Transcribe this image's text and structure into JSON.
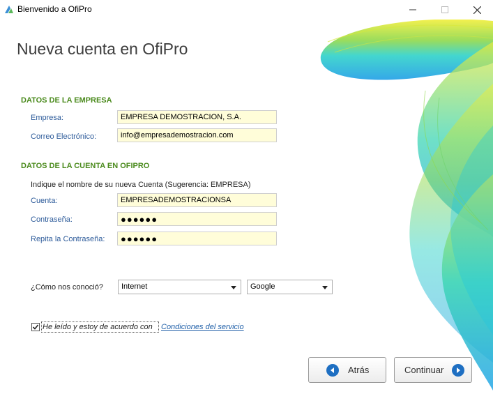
{
  "window": {
    "title": "Bienvenido a OfiPro"
  },
  "page": {
    "title": "Nueva cuenta en OfiPro"
  },
  "company_section": {
    "heading": "DATOS DE LA EMPRESA",
    "company_label": "Empresa:",
    "company_value": "EMPRESA DEMOSTRACION, S.A.",
    "email_label": "Correo Electrónico:",
    "email_value": "info@empresademostracion.com"
  },
  "account_section": {
    "heading": "DATOS DE LA CUENTA EN OFIPRO",
    "hint": "Indique el nombre de su nueva Cuenta  (Sugerencia: EMPRESA)",
    "account_label": "Cuenta:",
    "account_value": "EMPRESADEMOSTRACIONSA",
    "password_label": "Contraseña:",
    "password_value": "●●●●●●",
    "repeat_label": "Repita la Contraseña:",
    "repeat_value": "●●●●●●"
  },
  "referral": {
    "label": "¿Cómo nos conoció?",
    "source_value": "Internet",
    "detail_value": "Google"
  },
  "terms": {
    "checked": true,
    "label": "He leído y estoy de acuerdo con",
    "link": "Condiciones del servicio"
  },
  "buttons": {
    "back_label": "Atrás",
    "continue_label": "Continuar"
  },
  "colors": {
    "section_heading": "#4a8a1c",
    "field_label": "#2d5b9a",
    "input_bg": "#fffdd9",
    "button_icon": "#1e6fc2"
  }
}
